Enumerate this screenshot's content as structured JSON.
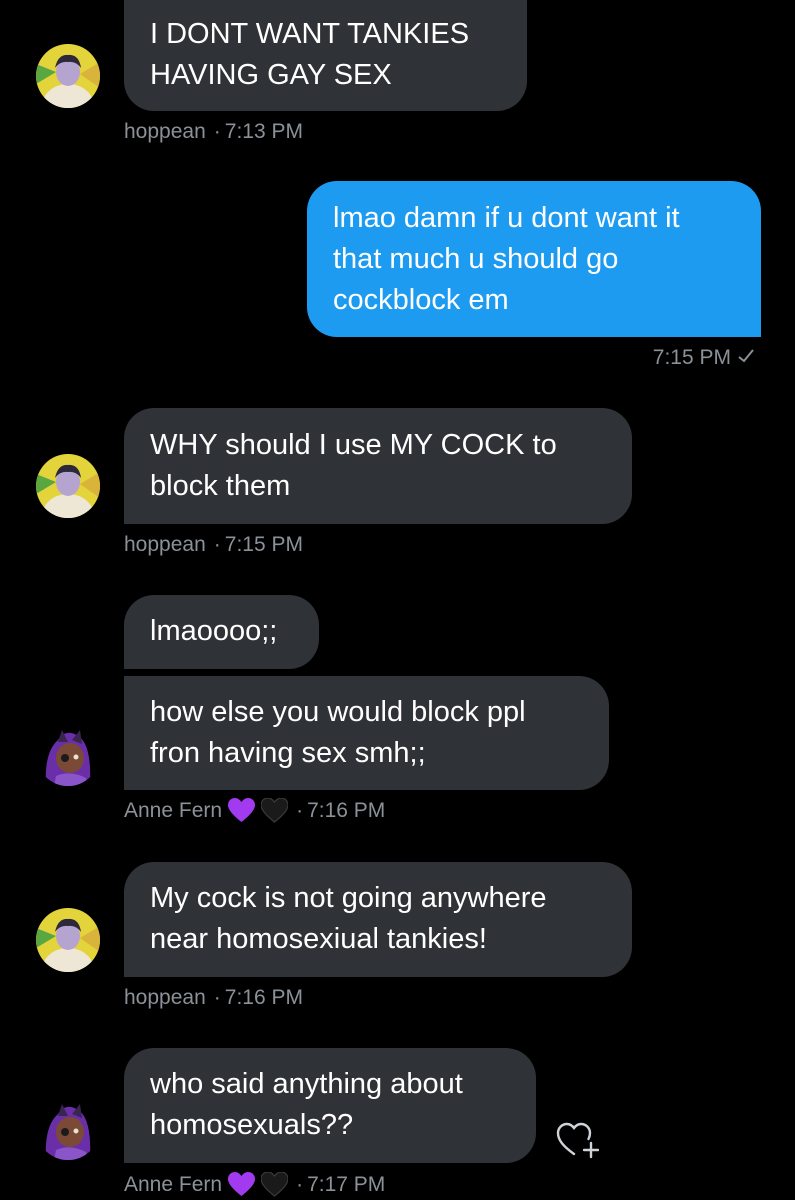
{
  "conversation": {
    "messages": [
      {
        "id": "m1",
        "text": "I DONT WANT TANKIES HAVING GAY SEX"
      },
      {
        "id": "m2",
        "text": "lmao damn if u dont want it that much u should go cockblock em"
      },
      {
        "id": "m3",
        "text": "WHY should I use MY COCK to block them"
      },
      {
        "id": "m4",
        "text": "lmaoooo;;"
      },
      {
        "id": "m5",
        "text": "how else you would block ppl fron having sex smh;;"
      },
      {
        "id": "m6",
        "text": "My cock is not going anywhere near homosexiual tankies!"
      },
      {
        "id": "m7",
        "text": "who said anything about homosexuals??"
      }
    ],
    "meta": [
      {
        "sender": "hoppean",
        "sep": "·",
        "time": "7:13 PM"
      },
      {
        "time": "7:15 PM"
      },
      {
        "sender": "hoppean",
        "sep": "·",
        "time": "7:15 PM"
      },
      {
        "sender": "Anne Fern",
        "sep": "·",
        "time": "7:16 PM"
      },
      {
        "sender": "hoppean",
        "sep": "·",
        "time": "7:16 PM"
      },
      {
        "sender": "Anne Fern",
        "sep": "·",
        "time": "7:17 PM"
      }
    ]
  },
  "colors": {
    "background": "#000000",
    "incoming_bubble": "#2f3236",
    "outgoing_bubble": "#1d9bf0",
    "meta_text": "#8b9198",
    "purple_heart": "#a23bf0"
  },
  "icons": {
    "read_receipt": "check-icon",
    "react": "heart-plus-icon",
    "emoji_1": "purple-heart-icon",
    "emoji_2": "black-heart-icon"
  }
}
